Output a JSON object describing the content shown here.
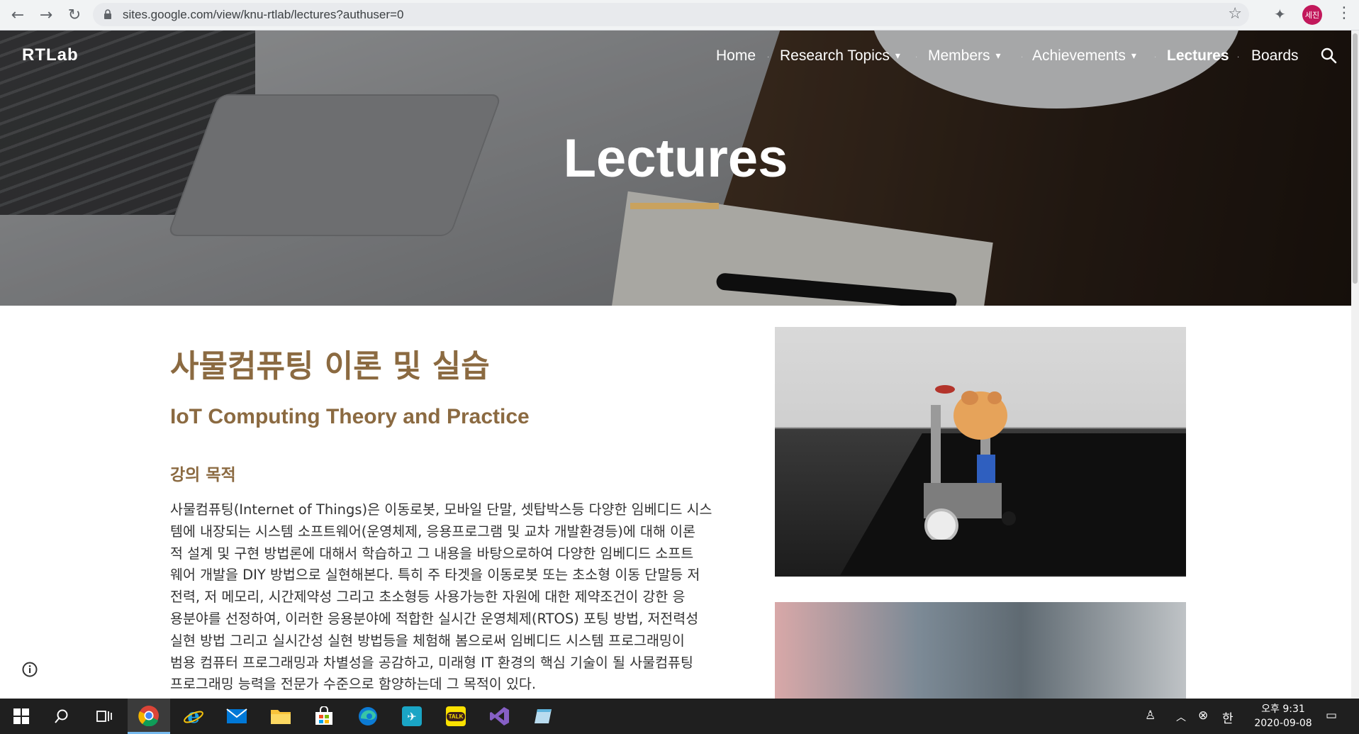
{
  "browser": {
    "url": "sites.google.com/view/knu-rtlab/lectures?authuser=0",
    "avatar_label": "세진",
    "icons": [
      "back-icon",
      "forward-icon",
      "reload-icon",
      "lock-icon",
      "star-icon",
      "extensions-icon",
      "kebab-menu-icon"
    ]
  },
  "site": {
    "brand": "RTLab",
    "nav": [
      {
        "label": "Home",
        "dropdown": false
      },
      {
        "label": "Research Topics",
        "dropdown": true
      },
      {
        "label": "Members",
        "dropdown": true
      },
      {
        "label": "Achievements",
        "dropdown": true
      },
      {
        "label": "Lectures",
        "dropdown": false,
        "active": true
      },
      {
        "label": "Boards",
        "dropdown": false
      }
    ],
    "hero_title": "Lectures",
    "accent_color": "#c9a25e",
    "heading_color": "#8b6a41"
  },
  "content": {
    "title_ko": "사물컴퓨팅 이론 및 실습",
    "title_en": "IoT Computing Theory and Practice",
    "section_heading": "강의 목적",
    "paragraph_lines": [
      "사물컴퓨팅(Internet of Things)은 이동로봇, 모바일 단말, 셋탑박스등 다양한 임베디드 시스",
      "템에 내장되는 시스템 소프트웨어(운영체제, 응용프로그램 및 교차 개발환경등)에 대해 이론",
      "적 설계 및 구현 방법론에 대해서 학습하고 그 내용을 바탕으로하여 다양한 임베디드 소프트",
      "웨어 개발을 DIY 방법으로 실현해본다. 특히 주 타겟을 이동로봇 또는 초소형 이동 단말등 저",
      "전력, 저 메모리, 시간제약성 그리고 초소형등 사용가능한 자원에 대한 제약조건이 강한 응",
      "용분야를 선정하여, 이러한 응용분야에 적합한 실시간 운영체제(RTOS) 포팅 방법, 저전력성",
      "실현 방법 그리고 실시간성 실현 방법등을 체험해 봄으로써 임베디드 시스템 프로그래밍이",
      "범용 컴퓨터 프로그래밍과 차별성을 공감하고, 미래형 IT 환경의 핵심 기술이 될 사물컴퓨팅",
      "프로그래밍 능력을 전문가 수준으로 함양하는데 그 목적이 있다."
    ]
  },
  "taskbar": {
    "apps": [
      "start-icon",
      "search-icon",
      "task-view-icon",
      "chrome-icon",
      "ie-icon",
      "mail-icon",
      "file-explorer-icon",
      "store-icon",
      "edge-icon",
      "app-icon",
      "kakaotalk-icon",
      "visual-studio-icon",
      "notepad-icon"
    ],
    "kakao_label": "TALK",
    "ime": "한",
    "clock_time": "오후 9:31",
    "clock_date": "2020-09-08"
  }
}
